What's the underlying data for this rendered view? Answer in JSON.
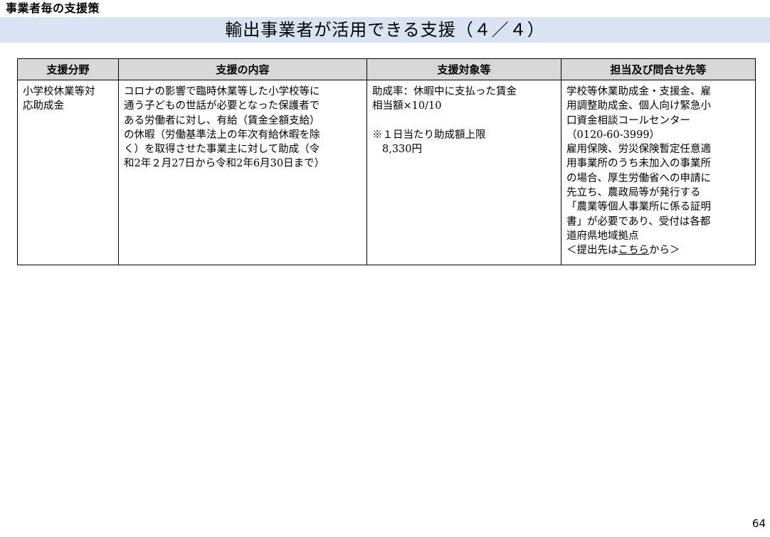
{
  "header": {
    "section_label": "事業者毎の支援策",
    "title": "輸出事業者が活用できる支援（４／４）"
  },
  "table": {
    "columns": [
      "支援分野",
      "支援の内容",
      "支援対象等",
      "担当及び問合せ先等"
    ],
    "row": {
      "field": [
        "小学校休業等対",
        "応助成金"
      ],
      "content": [
        "コロナの影響で臨時休業等した小学校等に",
        "通う子どもの世話が必要となった保護者で",
        "ある労働者に対し、有給（賃金全額支給）",
        "の休暇（労働基準法上の年次有給休暇を除",
        "く）を取得させた事業主に対して助成（令",
        "和2年２月27日から令和2年6月30日まで）"
      ],
      "target": {
        "rate_lines": [
          "助成率：休暇中に支払った賃金",
          "相当額×10/10"
        ],
        "note": "※１日当たり助成額上限",
        "limit": "8,330円"
      },
      "contact": {
        "lines": [
          "学校等休業助成金・支援金、雇",
          "用調整助成金、個人向け緊急小",
          "口資金相談コールセンター",
          "（0120-60-3999）",
          "雇用保険、労災保険暫定任意適",
          "用事業所のうち未加入の事業所",
          "の場合、厚生労働省への申請に",
          "先立ち、農政局等が発行する",
          "「農業等個人事業所に係る証明",
          "書」が必要であり、受付は各都",
          "道府県地域拠点"
        ],
        "submit_prefix": "＜提出先は",
        "submit_link": "こちら",
        "submit_suffix": "から＞"
      }
    }
  },
  "footer": {
    "page_number": "64"
  }
}
